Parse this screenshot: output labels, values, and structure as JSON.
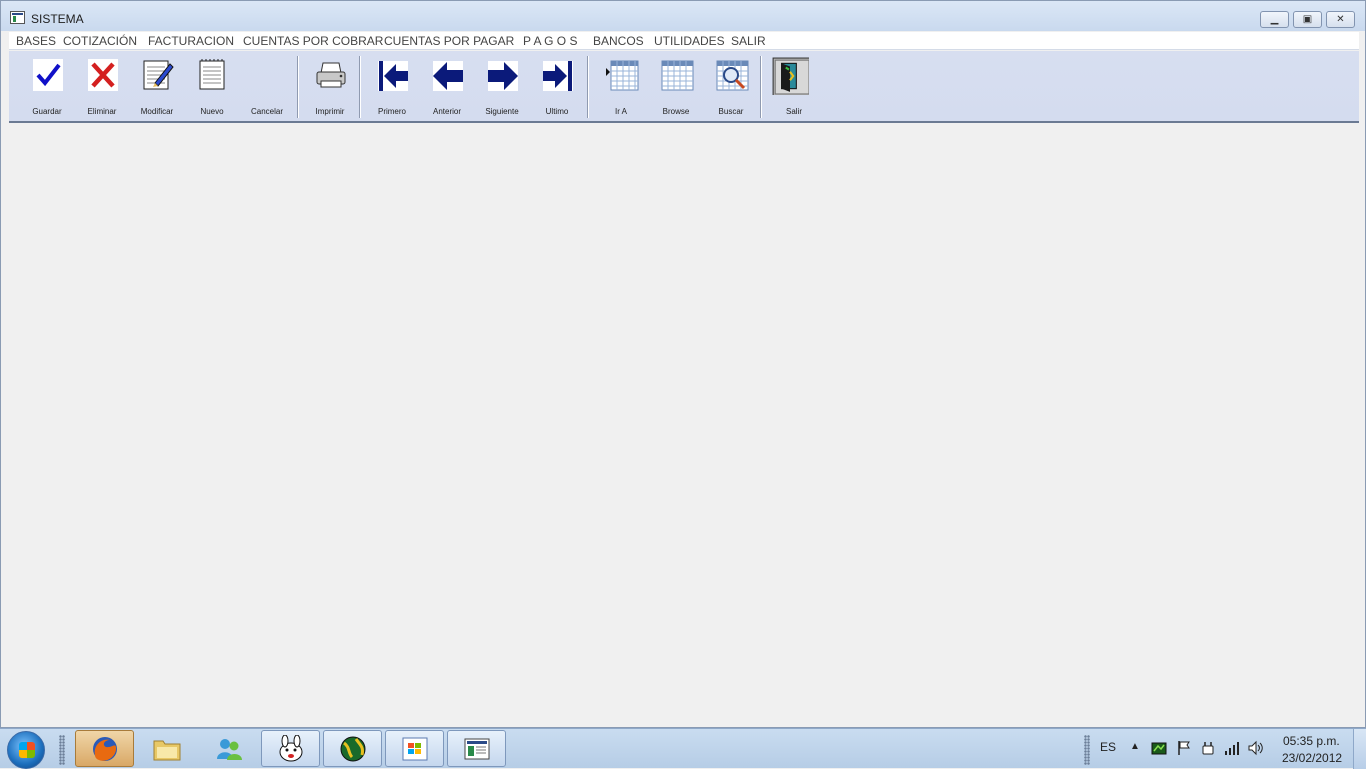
{
  "window": {
    "title": "SISTEMA",
    "minimize_icon": "minimize-icon",
    "maximize_icon": "restore-icon",
    "close_icon": "close-icon"
  },
  "menu": {
    "items": [
      "BASES",
      "COTIZACIÓN",
      "FACTURACION",
      "CUENTAS POR COBRAR",
      "CUENTAS POR PAGAR",
      "P A G O S",
      "BANCOS",
      "UTILIDADES",
      "SALIR"
    ]
  },
  "toolbar": {
    "buttons": [
      {
        "label": "Guardar",
        "icon": "checkmark-icon"
      },
      {
        "label": "Eliminar",
        "icon": "delete-x-icon"
      },
      {
        "label": "Modificar",
        "icon": "edit-notepad-icon"
      },
      {
        "label": "Nuevo",
        "icon": "new-notepad-icon"
      },
      {
        "label": "Cancelar",
        "icon": ""
      },
      {
        "label": "Imprimir",
        "icon": "printer-icon"
      },
      {
        "label": "Primero",
        "icon": "first-record-icon"
      },
      {
        "label": "Anterior",
        "icon": "previous-arrow-icon"
      },
      {
        "label": "Siguiente",
        "icon": "next-arrow-icon"
      },
      {
        "label": "Ultimo",
        "icon": "last-record-icon"
      },
      {
        "label": "Ir A",
        "icon": "goto-grid-icon"
      },
      {
        "label": "Browse",
        "icon": "browse-grid-icon"
      },
      {
        "label": "Buscar",
        "icon": "search-grid-icon"
      },
      {
        "label": "Salir",
        "icon": "exit-door-icon"
      }
    ]
  },
  "taskbar": {
    "language": "ES",
    "time": "05:35 p.m.",
    "date": "23/02/2012",
    "apps": [
      "firefox-icon",
      "folder-icon",
      "messenger-icon",
      "rabbit-app-icon",
      "globe-app-icon",
      "windows-app-icon",
      "sistema-app-icon"
    ]
  },
  "colors": {
    "toolbar_bg": "#d4dcef",
    "nav_arrow": "#0b1a7a",
    "taskbar": "#bcd2ea"
  }
}
